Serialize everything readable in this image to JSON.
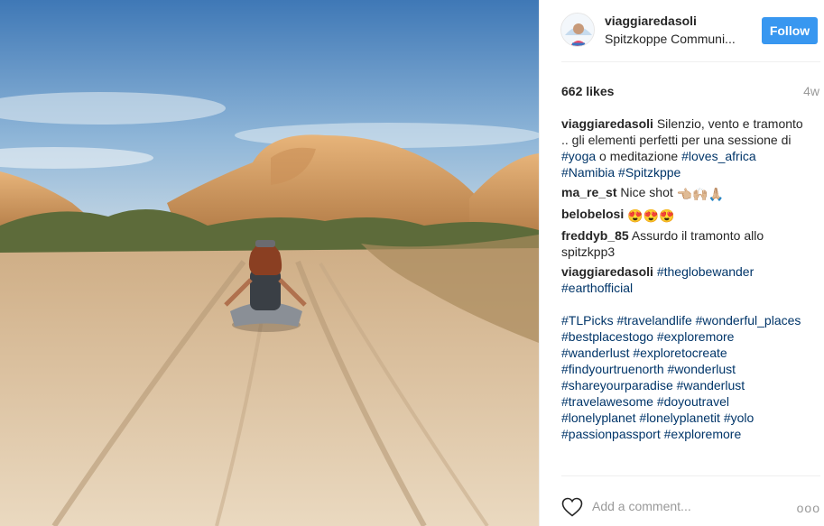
{
  "post": {
    "username": "viaggiaredasoli",
    "location": "Spitzkoppe Communi...",
    "follow_label": "Follow",
    "likes": "662 likes",
    "age": "4w"
  },
  "comments": [
    {
      "user": "viaggiaredasoli",
      "parts": [
        {
          "t": " Silenzio, vento e tramonto .. gli elementi perfetti per una sessione di "
        },
        {
          "tag": "#yoga"
        },
        {
          "t": " o meditazione "
        },
        {
          "tag": "#loves_africa"
        },
        {
          "t": " "
        },
        {
          "tag": "#Namibia"
        },
        {
          "t": " "
        },
        {
          "tag": "#Spitzkppe"
        }
      ]
    },
    {
      "user": "ma_re_st",
      "parts": [
        {
          "t": " Nice shot "
        },
        {
          "emoji": "👈🏼🙌🏼🙏🏼"
        }
      ]
    },
    {
      "user": "belobelosi",
      "parts": [
        {
          "t": " "
        },
        {
          "emoji": "😍😍😍"
        }
      ]
    },
    {
      "user": "freddyb_85",
      "parts": [
        {
          "t": " Assurdo il tramonto allo spitzkpp3"
        }
      ]
    },
    {
      "user": "viaggiaredasoli",
      "parts": [
        {
          "t": " "
        },
        {
          "tag": "#theglobewander"
        },
        {
          "t": " "
        },
        {
          "tag": "#earthofficial"
        },
        {
          "br": true
        },
        {
          "br": true
        },
        {
          "tag": "#TLPicks"
        },
        {
          "t": " "
        },
        {
          "tag": "#travelandlife"
        },
        {
          "t": " "
        },
        {
          "tag": "#wonderful_places"
        },
        {
          "t": " "
        },
        {
          "tag": "#bestplacestogo"
        },
        {
          "t": " "
        },
        {
          "tag": "#exploremore"
        },
        {
          "t": " "
        },
        {
          "tag": "#wanderlust"
        },
        {
          "t": " "
        },
        {
          "tag": "#exploretocreate"
        },
        {
          "t": " "
        },
        {
          "tag": "#findyourtruenorth"
        },
        {
          "t": " "
        },
        {
          "tag": "#wonderlust"
        },
        {
          "t": " "
        },
        {
          "tag": "#shareyourparadise"
        },
        {
          "t": " "
        },
        {
          "tag": "#wanderlust"
        },
        {
          "t": " "
        },
        {
          "tag": "#travelawesome"
        },
        {
          "t": " "
        },
        {
          "tag": "#doyoutravel"
        },
        {
          "t": " "
        },
        {
          "tag": "#lonelyplanet"
        },
        {
          "t": " "
        },
        {
          "tag": "#lonelyplanetit"
        },
        {
          "t": " "
        },
        {
          "tag": "#yolo"
        },
        {
          "t": " "
        },
        {
          "tag": "#passionpassport"
        },
        {
          "t": " "
        },
        {
          "tag": "#exploremore"
        }
      ]
    }
  ],
  "footer": {
    "add_comment_placeholder": "Add a comment...",
    "more_label": "ooo"
  },
  "icons": {
    "like": "heart-icon",
    "more": "more-options-icon"
  },
  "colors": {
    "follow_button": "#3897f0",
    "hashtag": "#003569",
    "muted": "#999999"
  }
}
